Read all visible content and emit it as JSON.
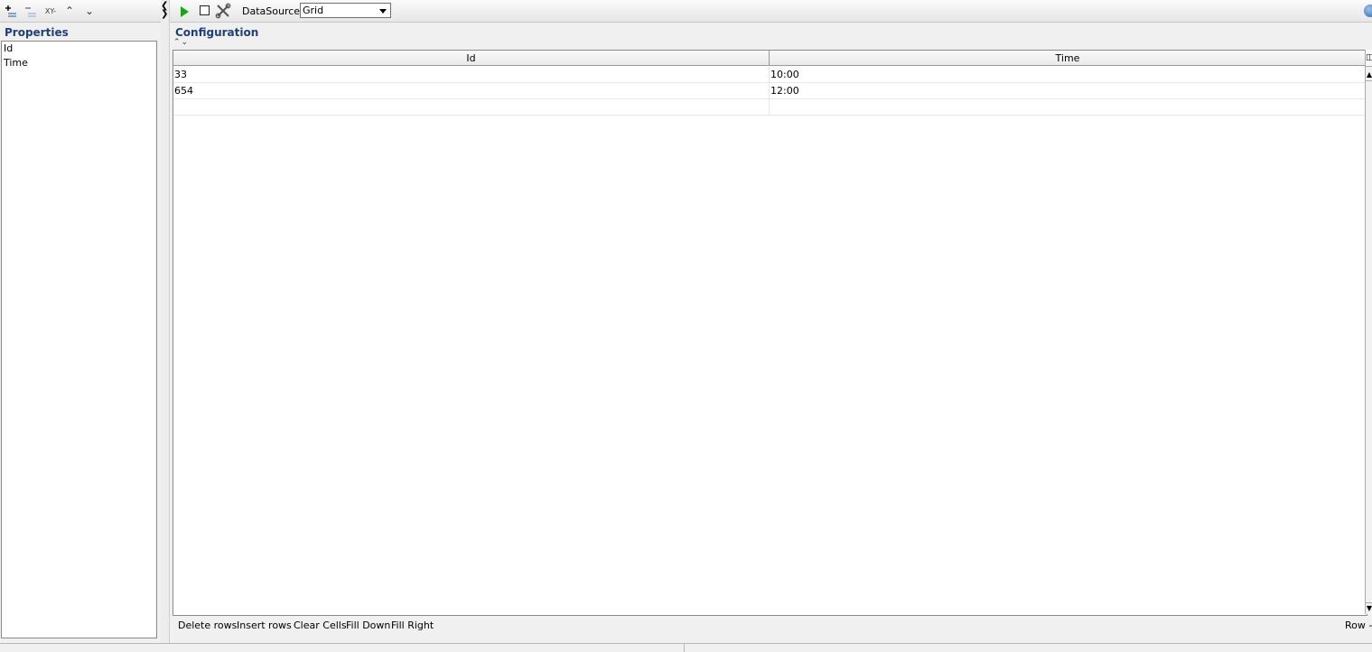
{
  "left_toolbar": {
    "icons": [
      "add-row-icon",
      "remove-row-icon",
      "xy-icon",
      "move-up-icon",
      "move-down-icon"
    ],
    "xy_label": "XY-",
    "up_glyph": "⌃",
    "down_glyph": "⌄"
  },
  "properties": {
    "title": "Properties",
    "items": [
      "Id",
      "Time"
    ]
  },
  "toolbar": {
    "datasource_label": "DataSource:",
    "datasource_value": "Grid"
  },
  "configuration": {
    "title": "Configuration",
    "sort_glyphs": "⌃⌄"
  },
  "grid": {
    "columns": [
      "Id",
      "Time"
    ],
    "rows": [
      [
        "33",
        "10:00"
      ],
      [
        "654",
        "12:00"
      ],
      [
        "",
        ""
      ]
    ]
  },
  "actions": {
    "delete_rows": "Delete rows",
    "insert_rows": "Insert rows",
    "clear_cells": "Clear Cells",
    "fill_down": "Fill Down",
    "fill_right": "Fill Right",
    "row": "Row -"
  },
  "colors": {
    "title_blue": "#1f3f7a",
    "play_green": "#1aa31a"
  }
}
